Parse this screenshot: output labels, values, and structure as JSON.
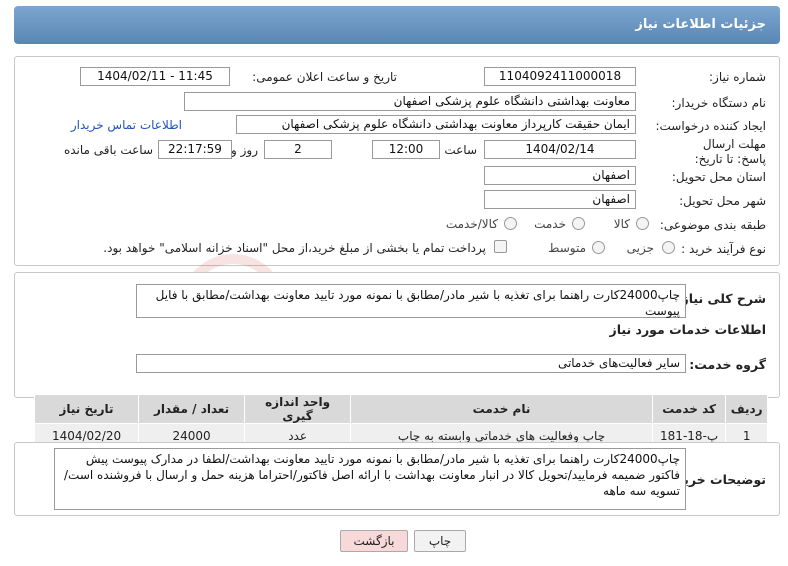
{
  "header": {
    "title": "جزئیات اطلاعات نیاز"
  },
  "need": {
    "number_label": "شماره نیاز:",
    "number": "1104092411000018",
    "announce_label": "تاریخ و ساعت اعلان عمومی:",
    "announce_value": "1404/02/11 - 11:45",
    "buyer_label": "نام دستگاه خریدار:",
    "buyer": "معاونت بهداشتی دانشگاه علوم پزشکی اصفهان",
    "requester_label": "ایجاد کننده درخواست:",
    "requester": "ایمان حقیقت کارپرداز معاونت بهداشتی دانشگاه علوم پزشکی اصفهان",
    "contact_link": "اطلاعات تماس خریدار",
    "deadline_label": "مهلت ارسال پاسخ: تا تاریخ:",
    "deadline_date": "1404/02/14",
    "time_label": "ساعت",
    "deadline_time": "12:00",
    "days": "2",
    "days_label": "روز و",
    "remaining": "22:17:59",
    "remaining_label": "ساعت باقی مانده",
    "province_label": "استان محل تحویل:",
    "province": "اصفهان",
    "city_label": "شهر محل تحویل:",
    "city": "اصفهان",
    "category_label": "طبقه بندی موضوعی:",
    "category_options": [
      "کالا",
      "خدمت",
      "کالا/خدمت"
    ],
    "process_label": "نوع فرآیند خرید :",
    "process_options": [
      "جزیی",
      "متوسط"
    ],
    "treasury_note": "پرداخت تمام یا بخشی از مبلغ خرید،از محل \"اسناد خزانه اسلامی\" خواهد بود."
  },
  "summary": {
    "label": "شرح کلی نیاز:",
    "text": "چاپ24000کارت راهنما برای تغذیه با شیر مادر/مطابق با نمونه مورد تایید معاونت بهداشت/مطابق با فایل پیوست"
  },
  "services": {
    "section_title": "اطلاعات خدمات مورد نیاز",
    "group_label": "گروه خدمت:",
    "group_value": "سایر فعالیت‌های خدماتی",
    "columns": [
      "ردیف",
      "کد خدمت",
      "نام خدمت",
      "واحد اندازه گیری",
      "تعداد / مقدار",
      "تاریخ نیاز"
    ],
    "rows": [
      {
        "row": "1",
        "code": "پ-18-181",
        "name": "چاپ وفعالیت های خدماتی وابسته به چاپ",
        "unit": "عدد",
        "qty": "24000",
        "date": "1404/02/20"
      }
    ]
  },
  "buyer_notes": {
    "label": "توضیحات خریدار:",
    "text": "چاپ24000کارت راهنما برای تغذیه با شیر مادر/مطابق با نمونه مورد تایید معاونت بهداشت/لطفا در مدارک پیوست پیش فاکتور ضمیمه فرمایید/تحویل کالا در انبار معاونت بهداشت با ارائه اصل فاکتور/احتراما هزینه حمل و ارسال با فروشنده است/تسویه سه ماهه"
  },
  "buttons": {
    "print": "چاپ",
    "back": "بازگشت"
  },
  "watermark": {
    "text": "AriaTender.neT"
  },
  "colors": {
    "header": "#5a86b4",
    "link": "#1f56b3",
    "back_button": "#f8d9d9"
  }
}
